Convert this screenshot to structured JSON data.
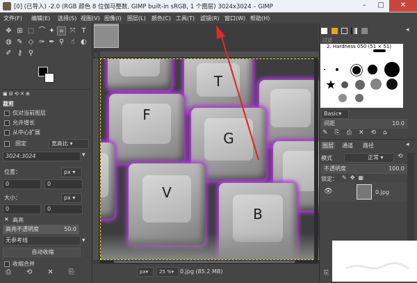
{
  "window": {
    "title": "[0] (已导入) -2.0 (RGB 颜色 8 位伽马整数, GIMP built-in sRGB, 1 个图层) 3024x3024 – GIMP",
    "minimize": "–",
    "maximize": "□",
    "close": "✕"
  },
  "menu": [
    "文件(F)",
    "编辑(E)",
    "选择(S)",
    "视图(V)",
    "图像(I)",
    "图层(L)",
    "颜色(C)",
    "工具(T)",
    "滤镜(R)",
    "窗口(W)",
    "帮助(H)"
  ],
  "tool_options": {
    "header": "裁剪",
    "only_current_layer": "仅对当前图层",
    "allow_growing": "允许增长",
    "expand_from_center": "从中心扩展",
    "fixed": "固定",
    "aspect": "宽高比",
    "ratio_value": "3024:3024",
    "position_label": "位置：",
    "position_unit": "px",
    "pos_x": "0",
    "pos_y": "0",
    "size_label": "大小：",
    "size_unit": "px",
    "size_w": "0",
    "size_h": "0",
    "highlight": "高亮",
    "highlight_opacity_label": "高亮不透明度",
    "highlight_opacity_value": "50.0",
    "guides": "无参考线",
    "auto_shrink": "自动收缩",
    "shrink_merged": "收缩合并"
  },
  "statusbar": {
    "unit": "px",
    "zoom": "25 %",
    "file": "0.jpg (85.2 MB)"
  },
  "canvas_keys": [
    "F",
    "G",
    "V",
    "B"
  ],
  "brushes_panel": {
    "filter": "过滤",
    "brush_name": "2. Hardness 050 (51 × 51)",
    "preset": "Basic",
    "spacing_label": "间距",
    "spacing_value": "10.0"
  },
  "layers_panel": {
    "tabs": [
      "图层",
      "通道",
      "路径"
    ],
    "mode_label": "模式",
    "mode_value": "正常",
    "opacity_label": "不透明度",
    "opacity_value": "100.0",
    "lock_label": "锁定：",
    "layer_name": "0.jpg"
  },
  "colors": {
    "accent_red": "#e02a2a",
    "selection_dash": "#e8e020",
    "key_glow": "#b13bd8"
  }
}
